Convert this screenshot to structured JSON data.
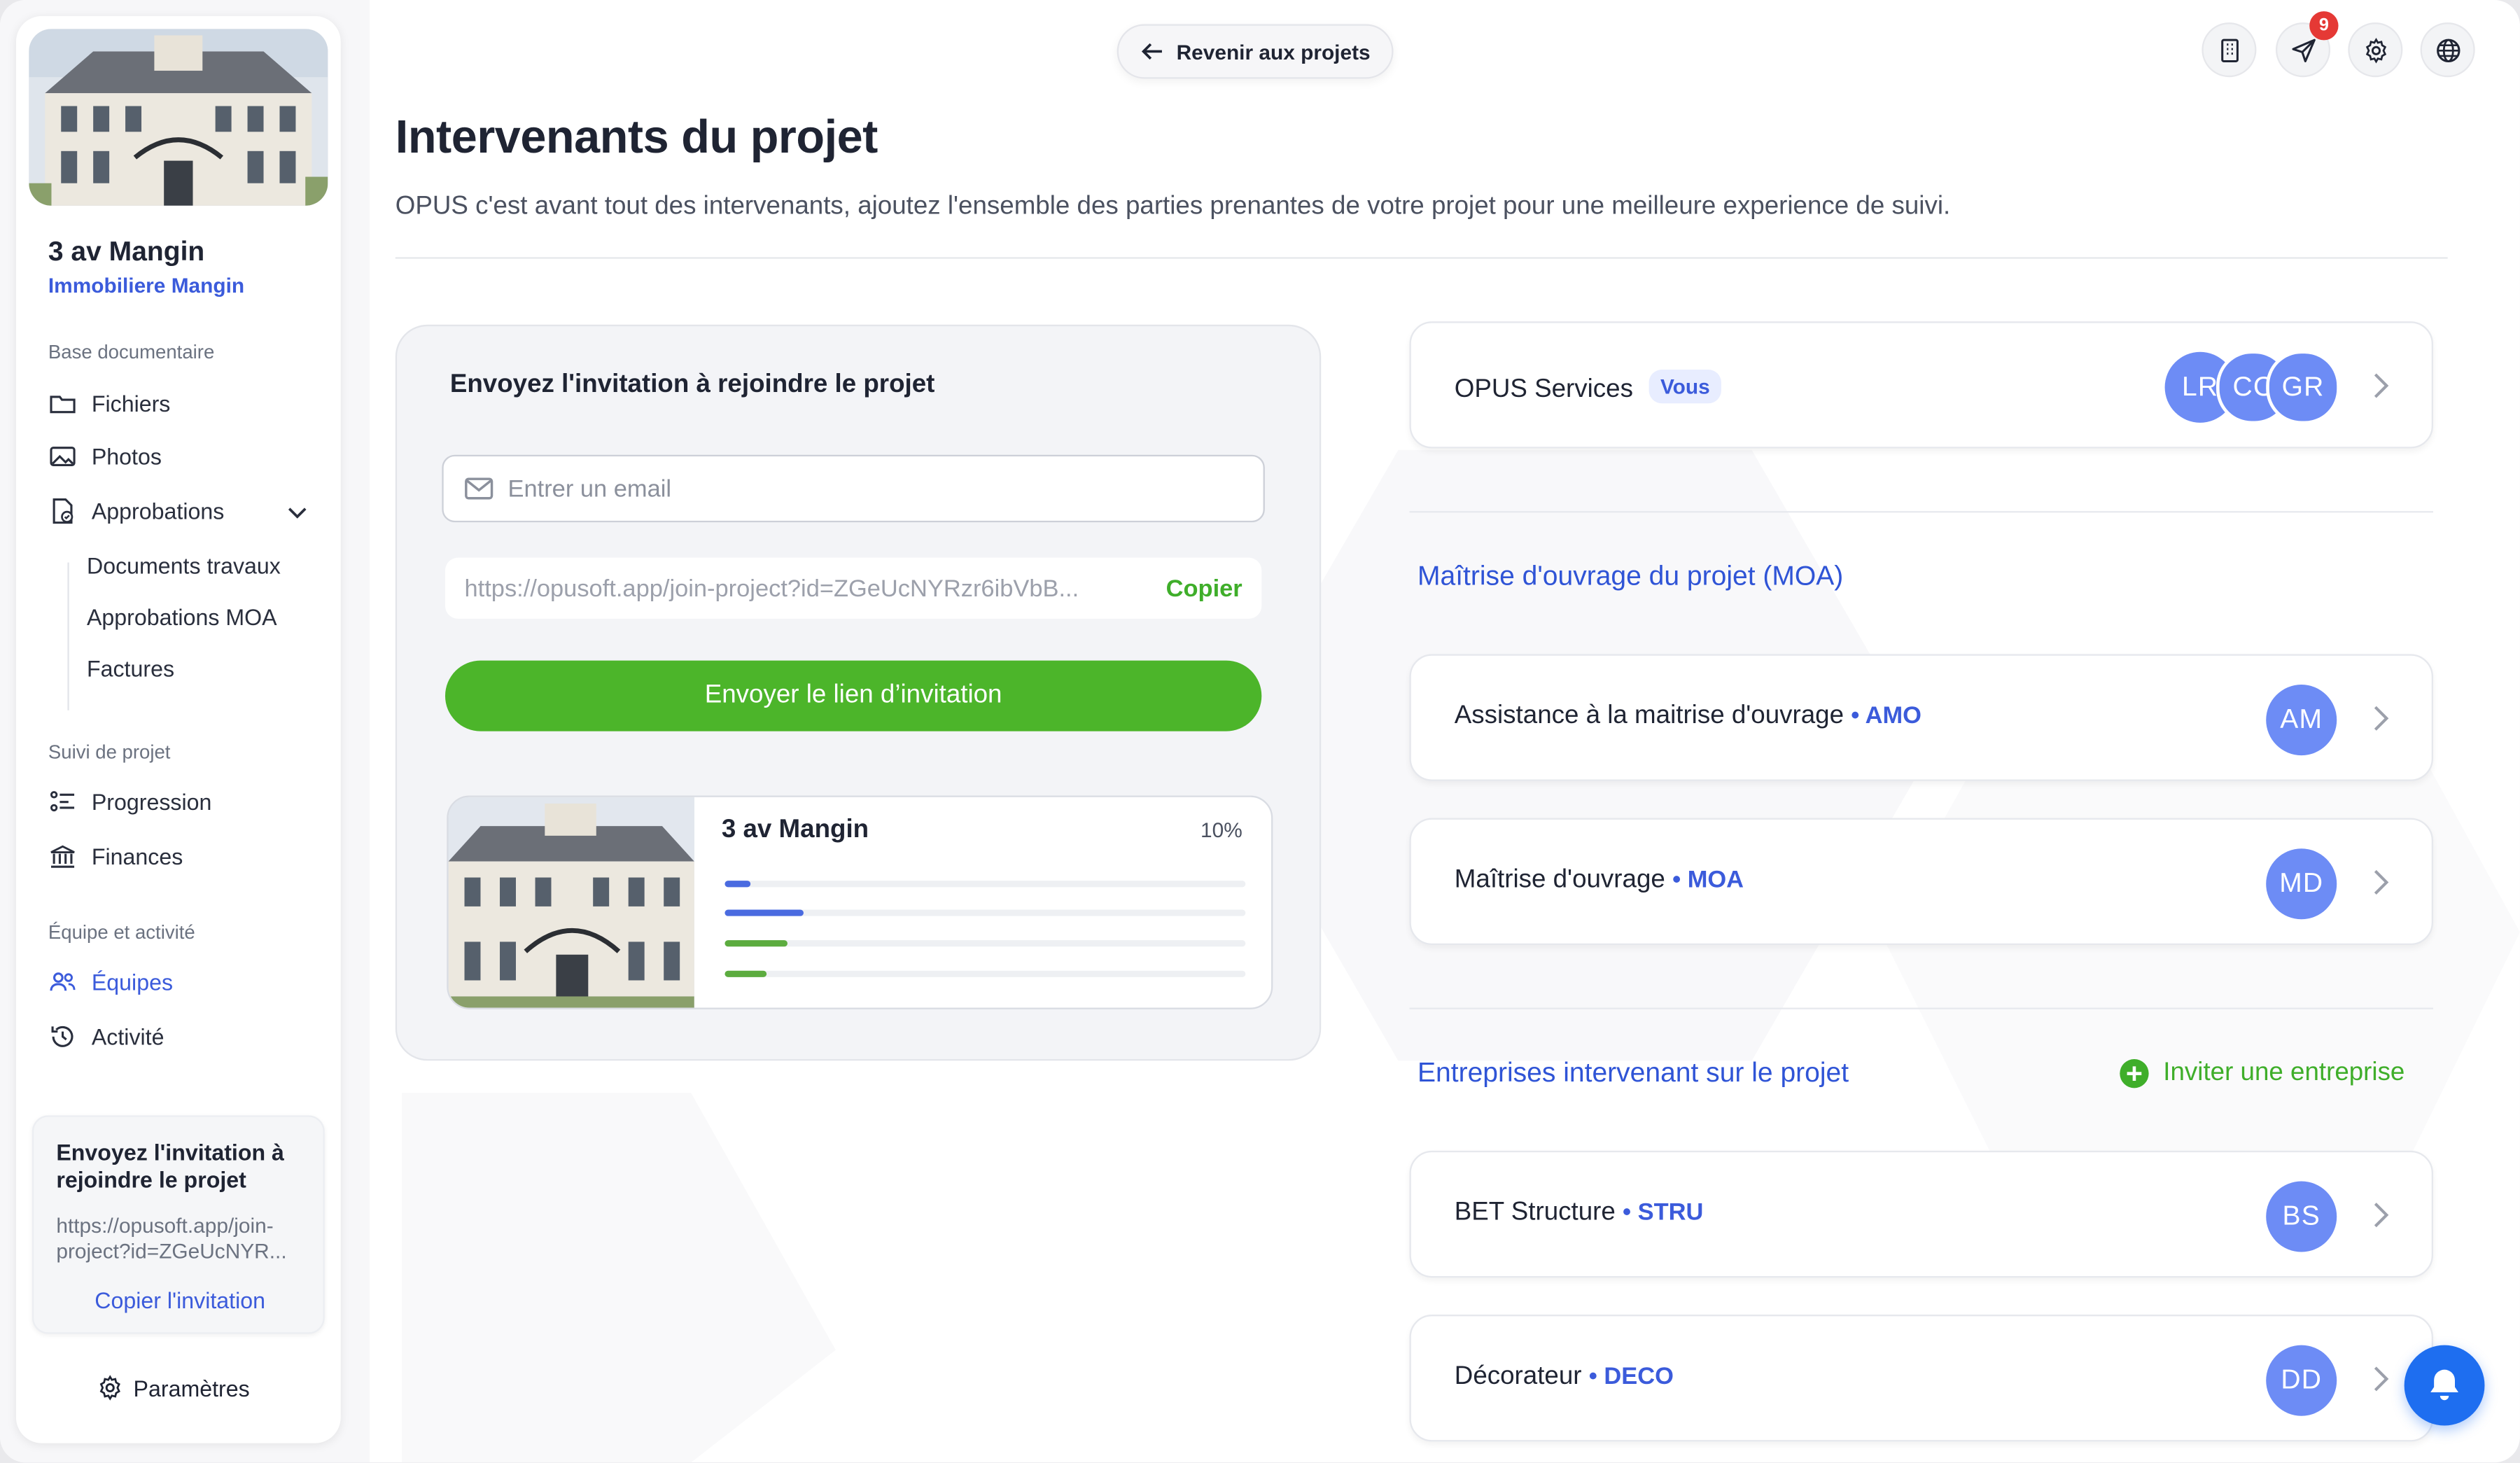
{
  "sidebar": {
    "project_name": "3 av Mangin",
    "company": "Immobiliere Mangin",
    "sections": {
      "docs": "Base documentaire",
      "follow": "Suivi de projet",
      "team": "Équipe et activité"
    },
    "items": {
      "files": "Fichiers",
      "photos": "Photos",
      "approvals": "Approbations",
      "progress": "Progression",
      "finances": "Finances",
      "teams": "Équipes",
      "activity": "Activité"
    },
    "sub_items": {
      "works_docs": "Documents travaux",
      "moa_approvals": "Approbations MOA",
      "invoices": "Factures"
    },
    "invite_card": {
      "title": "Envoyez l'invitation à rejoindre le projet",
      "url": "https://opusoft.app/join-project?id=ZGeUcNYR...",
      "copy": "Copier l'invitation"
    },
    "settings": "Paramètres"
  },
  "topbar": {
    "back": "Revenir aux projets",
    "notifications_count": "9"
  },
  "main": {
    "title": "Intervenants du projet",
    "subtitle": "OPUS c'est avant tout des intervenants, ajoutez l'ensemble des parties prenantes de votre projet pour une meilleure experience de suivi."
  },
  "invite_panel": {
    "title": "Envoyez l'invitation à rejoindre le projet",
    "email_placeholder": "Entrer un email",
    "link": "https://opusoft.app/join-project?id=ZGeUcNYRzr6ibVbB...",
    "copy": "Copier",
    "send": "Envoyer le lien d’invitation",
    "preview": {
      "name": "3 av Mangin",
      "percent": "10%",
      "bars": [
        {
          "fill": 0.05,
          "color": "#4a6be0"
        },
        {
          "fill": 0.15,
          "color": "#4a6be0"
        },
        {
          "fill": 0.12,
          "color": "#5cac3f"
        },
        {
          "fill": 0.08,
          "color": "#5cac3f"
        }
      ]
    }
  },
  "right": {
    "owner": {
      "label": "OPUS Services",
      "badge": "Vous",
      "avatars": [
        "LR",
        "CC",
        "GR"
      ]
    },
    "moa_title": "Maîtrise d'ouvrage du projet (MOA)",
    "moa": [
      {
        "label": "Assistance à la maitrise d'ouvrage",
        "tag": "• AMO",
        "avatar": "AM"
      },
      {
        "label": "Maîtrise d'ouvrage",
        "tag": "• MOA",
        "avatar": "MD"
      }
    ],
    "companies_title": "Entreprises intervenant sur le projet",
    "invite_company": "Inviter une entreprise",
    "companies": [
      {
        "label": "BET Structure",
        "tag": "• STRU",
        "avatar": "BS"
      },
      {
        "label": "Décorateur",
        "tag": "• DECO",
        "avatar": "DD"
      }
    ]
  },
  "colors": {
    "accent": "#3b5bdb",
    "green": "#4cb52a",
    "avatar": "#6d8cf5",
    "bell": "#1e6ef0"
  }
}
